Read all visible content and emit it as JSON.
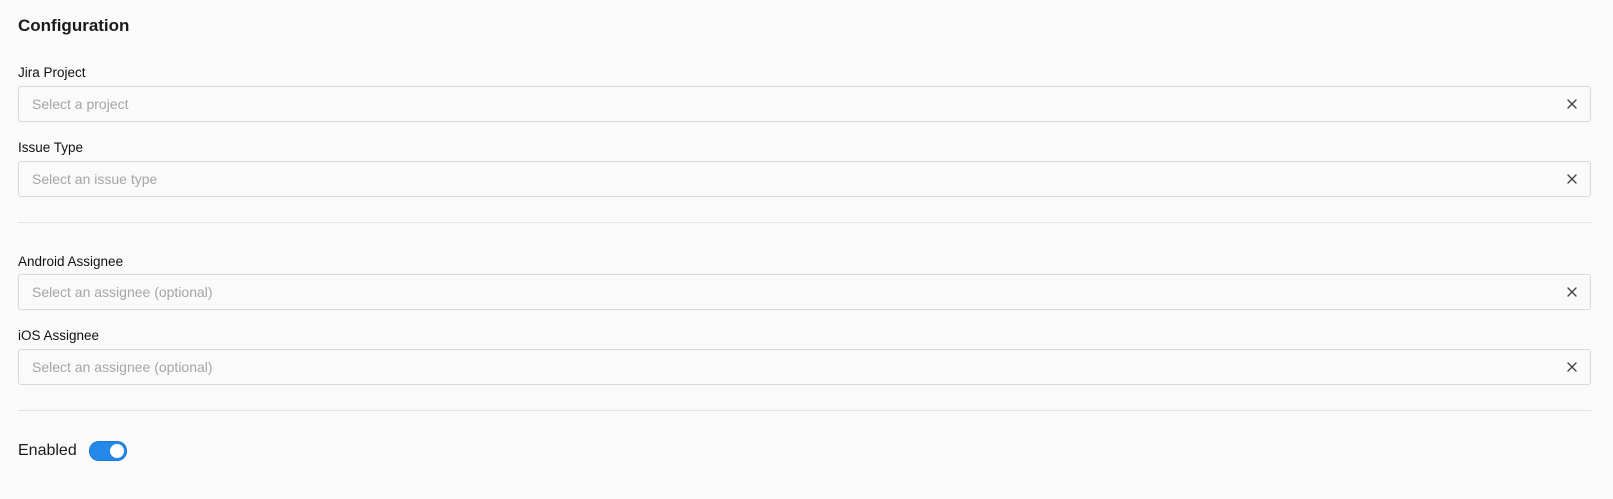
{
  "section": {
    "title": "Configuration"
  },
  "fields": {
    "jira_project": {
      "label": "Jira Project",
      "placeholder": "Select a project"
    },
    "issue_type": {
      "label": "Issue Type",
      "placeholder": "Select an issue type"
    },
    "android_assignee": {
      "label": "Android Assignee",
      "placeholder": "Select an assignee (optional)"
    },
    "ios_assignee": {
      "label": "iOS Assignee",
      "placeholder": "Select an assignee (optional)"
    }
  },
  "toggle": {
    "label": "Enabled",
    "on": true,
    "color": "#2389e8"
  },
  "icons": {
    "clear": "close-icon"
  }
}
